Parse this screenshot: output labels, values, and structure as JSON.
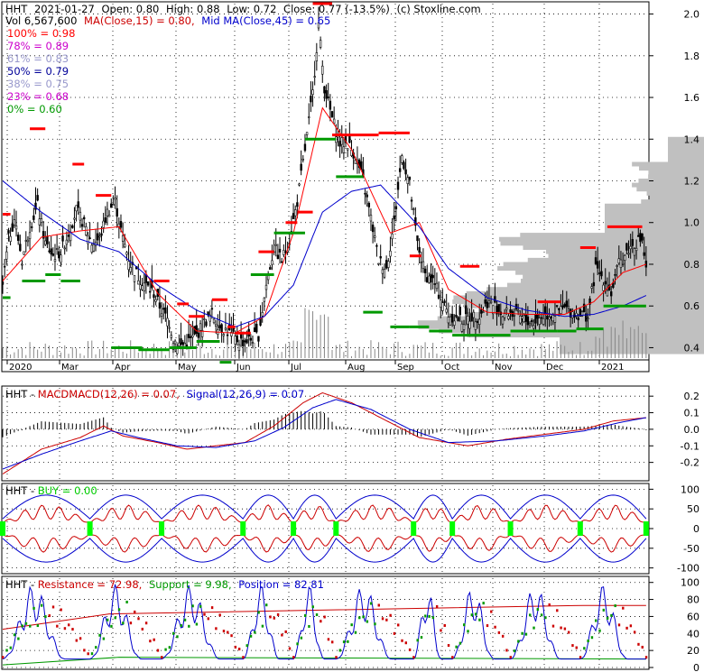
{
  "header": {
    "ticker": "HHT",
    "date": "2021-01-27",
    "open": "Open: 0.80",
    "high": "High: 0.88",
    "low": "Low: 0.72",
    "close": "Close: 0.77 (-13.5%)",
    "source": "(c) Stoxline.com",
    "volume": "Vol 6,567,600",
    "ma15": "MA(Close,15) = 0.80,",
    "ma45": "Mid MA(Close,45) = 0.65"
  },
  "fib_levels": [
    {
      "label": "100% = 0.98",
      "color": "#ff0000"
    },
    {
      "label": "78% = 0.89",
      "color": "#cc00cc"
    },
    {
      "label": "61% = 0.83",
      "color": "#9999cc"
    },
    {
      "label": "50% = 0.79",
      "color": "#000099"
    },
    {
      "label": "38% = 0.75",
      "color": "#9999cc"
    },
    {
      "label": "23% = 0.68",
      "color": "#cc00cc"
    },
    {
      "label": "0% = 0.60",
      "color": "#009900"
    }
  ],
  "colors": {
    "ma15": "#ff0000",
    "ma45": "#0000cc",
    "resistance": "#ff0000",
    "support": "#009900",
    "price": "#000000",
    "volume_profile": "#c0c0c0",
    "buy": "#00ff00",
    "position": "#0000cc"
  },
  "chart_data": [
    {
      "type": "candlestick",
      "title": "HHT 2021-01-27 Open: 0.80 High: 0.88 Low: 0.72 Close: 0.77 (-13.5%) (c) Stoxline.com",
      "x_ticks": [
        "2020",
        "Mar",
        "Apr",
        "May",
        "Jun",
        "Jul",
        "Aug",
        "Sep",
        "Oct",
        "Nov",
        "Dec",
        "2021"
      ],
      "y_ticks": [
        2.0,
        1.8,
        1.6,
        1.4,
        1.2,
        1.0,
        0.8,
        0.6,
        0.4
      ],
      "ylim": [
        0.35,
        2.05
      ],
      "price_path": [
        [
          0,
          0.7
        ],
        [
          3,
          0.92
        ],
        [
          6,
          1.02
        ],
        [
          10,
          0.82
        ],
        [
          14,
          0.98
        ],
        [
          18,
          1.08
        ],
        [
          22,
          0.9
        ],
        [
          26,
          0.84
        ],
        [
          30,
          0.86
        ],
        [
          34,
          0.95
        ],
        [
          38,
          1.06
        ],
        [
          42,
          0.99
        ],
        [
          46,
          0.9
        ],
        [
          50,
          0.92
        ],
        [
          54,
          1.05
        ],
        [
          58,
          1.1
        ],
        [
          62,
          0.92
        ],
        [
          66,
          0.8
        ],
        [
          70,
          0.74
        ],
        [
          74,
          0.7
        ],
        [
          78,
          0.66
        ],
        [
          82,
          0.58
        ],
        [
          86,
          0.52
        ],
        [
          88,
          0.44
        ],
        [
          92,
          0.41
        ],
        [
          96,
          0.43
        ],
        [
          100,
          0.46
        ],
        [
          104,
          0.52
        ],
        [
          108,
          0.56
        ],
        [
          112,
          0.5
        ],
        [
          116,
          0.48
        ],
        [
          120,
          0.44
        ],
        [
          124,
          0.43
        ],
        [
          128,
          0.44
        ],
        [
          132,
          0.46
        ],
        [
          136,
          0.7
        ],
        [
          140,
          0.88
        ],
        [
          144,
          0.82
        ],
        [
          148,
          0.92
        ],
        [
          152,
          1.1
        ],
        [
          156,
          1.35
        ],
        [
          160,
          1.62
        ],
        [
          163,
          1.95
        ],
        [
          166,
          1.65
        ],
        [
          170,
          1.5
        ],
        [
          174,
          1.38
        ],
        [
          178,
          1.38
        ],
        [
          182,
          1.32
        ],
        [
          186,
          1.2
        ],
        [
          190,
          1.02
        ],
        [
          194,
          0.82
        ],
        [
          198,
          0.78
        ],
        [
          202,
          1.0
        ],
        [
          206,
          1.32
        ],
        [
          210,
          1.18
        ],
        [
          214,
          0.9
        ],
        [
          218,
          0.75
        ],
        [
          222,
          0.72
        ],
        [
          226,
          0.64
        ],
        [
          230,
          0.56
        ],
        [
          234,
          0.54
        ],
        [
          238,
          0.53
        ],
        [
          242,
          0.55
        ],
        [
          246,
          0.55
        ],
        [
          250,
          0.62
        ],
        [
          254,
          0.6
        ],
        [
          258,
          0.56
        ],
        [
          262,
          0.57
        ],
        [
          266,
          0.55
        ],
        [
          270,
          0.53
        ],
        [
          274,
          0.52
        ],
        [
          278,
          0.55
        ],
        [
          282,
          0.56
        ],
        [
          286,
          0.57
        ],
        [
          290,
          0.59
        ],
        [
          294,
          0.57
        ],
        [
          298,
          0.56
        ],
        [
          302,
          0.55
        ],
        [
          306,
          0.78
        ],
        [
          310,
          0.73
        ],
        [
          314,
          0.66
        ],
        [
          318,
          0.8
        ],
        [
          322,
          0.86
        ],
        [
          326,
          0.9
        ],
        [
          330,
          0.92
        ],
        [
          332,
          0.77
        ]
      ],
      "ma15": [
        [
          0,
          0.72
        ],
        [
          20,
          0.93
        ],
        [
          40,
          0.96
        ],
        [
          60,
          0.98
        ],
        [
          80,
          0.66
        ],
        [
          100,
          0.48
        ],
        [
          120,
          0.47
        ],
        [
          135,
          0.55
        ],
        [
          150,
          0.95
        ],
        [
          165,
          1.55
        ],
        [
          180,
          1.35
        ],
        [
          200,
          0.95
        ],
        [
          215,
          1.0
        ],
        [
          230,
          0.68
        ],
        [
          250,
          0.57
        ],
        [
          270,
          0.56
        ],
        [
          290,
          0.56
        ],
        [
          305,
          0.62
        ],
        [
          320,
          0.76
        ],
        [
          332,
          0.8
        ]
      ],
      "ma45": [
        [
          0,
          1.2
        ],
        [
          20,
          1.05
        ],
        [
          40,
          0.92
        ],
        [
          60,
          0.86
        ],
        [
          80,
          0.7
        ],
        [
          100,
          0.58
        ],
        [
          120,
          0.5
        ],
        [
          135,
          0.55
        ],
        [
          150,
          0.7
        ],
        [
          165,
          1.05
        ],
        [
          180,
          1.15
        ],
        [
          195,
          1.18
        ],
        [
          215,
          0.98
        ],
        [
          230,
          0.78
        ],
        [
          250,
          0.64
        ],
        [
          270,
          0.58
        ],
        [
          290,
          0.55
        ],
        [
          305,
          0.56
        ],
        [
          320,
          0.6
        ],
        [
          332,
          0.65
        ]
      ],
      "resistance_segments": [
        [
          0,
          4,
          1.04
        ],
        [
          14,
          22,
          1.45
        ],
        [
          36,
          42,
          1.28
        ],
        [
          48,
          56,
          1.13
        ],
        [
          78,
          86,
          0.72
        ],
        [
          90,
          96,
          0.61
        ],
        [
          96,
          104,
          0.55
        ],
        [
          108,
          116,
          0.63
        ],
        [
          116,
          120,
          0.5
        ],
        [
          120,
          128,
          0.47
        ],
        [
          132,
          140,
          0.86
        ],
        [
          146,
          152,
          1.0
        ],
        [
          152,
          160,
          1.05
        ],
        [
          160,
          170,
          2.05
        ],
        [
          170,
          194,
          1.42
        ],
        [
          194,
          210,
          1.43
        ],
        [
          210,
          216,
          0.84
        ],
        [
          236,
          246,
          0.79
        ],
        [
          276,
          288,
          0.62
        ],
        [
          298,
          306,
          0.88
        ],
        [
          312,
          330,
          0.98
        ]
      ],
      "support_segments": [
        [
          0,
          4,
          0.64
        ],
        [
          10,
          22,
          0.72
        ],
        [
          22,
          30,
          0.75
        ],
        [
          30,
          40,
          0.72
        ],
        [
          56,
          72,
          0.4
        ],
        [
          70,
          86,
          0.39
        ],
        [
          86,
          100,
          0.4
        ],
        [
          100,
          112,
          0.43
        ],
        [
          112,
          118,
          0.33
        ],
        [
          128,
          140,
          0.75
        ],
        [
          140,
          156,
          0.95
        ],
        [
          156,
          172,
          1.4
        ],
        [
          172,
          186,
          1.22
        ],
        [
          186,
          196,
          0.57
        ],
        [
          200,
          210,
          0.5
        ],
        [
          210,
          220,
          0.5
        ],
        [
          220,
          232,
          0.48
        ],
        [
          232,
          262,
          0.46
        ],
        [
          262,
          286,
          0.48
        ],
        [
          286,
          296,
          0.48
        ],
        [
          296,
          310,
          0.49
        ],
        [
          310,
          332,
          0.6
        ]
      ]
    },
    {
      "type": "line",
      "title": "HHT - MACDMACD(12,26) = 0.07, Signal(12,26,9) = 0.07",
      "y_ticks": [
        0.2,
        0.1,
        0.0,
        -0.1,
        -0.2
      ],
      "ylim": [
        -0.3,
        0.25
      ],
      "series": [
        {
          "name": "MACD(12,26)",
          "values": [
            [
              0,
              -0.27
            ],
            [
              20,
              -0.12
            ],
            [
              40,
              -0.05
            ],
            [
              52,
              0.02
            ],
            [
              62,
              -0.04
            ],
            [
              80,
              -0.08
            ],
            [
              95,
              -0.12
            ],
            [
              110,
              -0.1
            ],
            [
              125,
              -0.08
            ],
            [
              140,
              0.02
            ],
            [
              155,
              0.16
            ],
            [
              165,
              0.22
            ],
            [
              180,
              0.16
            ],
            [
              200,
              0.04
            ],
            [
              215,
              -0.05
            ],
            [
              240,
              -0.1
            ],
            [
              260,
              -0.06
            ],
            [
              280,
              -0.03
            ],
            [
              300,
              0.0
            ],
            [
              315,
              0.05
            ],
            [
              332,
              0.07
            ]
          ]
        },
        {
          "name": "Signal(12,26,9)",
          "values": [
            [
              0,
              -0.24
            ],
            [
              20,
              -0.15
            ],
            [
              40,
              -0.07
            ],
            [
              56,
              -0.01
            ],
            [
              70,
              -0.05
            ],
            [
              90,
              -0.1
            ],
            [
              110,
              -0.11
            ],
            [
              130,
              -0.07
            ],
            [
              145,
              0.01
            ],
            [
              160,
              0.13
            ],
            [
              172,
              0.18
            ],
            [
              190,
              0.12
            ],
            [
              210,
              0.0
            ],
            [
              230,
              -0.08
            ],
            [
              255,
              -0.07
            ],
            [
              280,
              -0.04
            ],
            [
              300,
              -0.01
            ],
            [
              318,
              0.04
            ],
            [
              332,
              0.07
            ]
          ]
        }
      ]
    },
    {
      "type": "line",
      "title": "HHT - BUY = 0.00",
      "y_ticks": [
        100,
        50,
        0,
        -50,
        -100
      ],
      "ylim": [
        -110,
        110
      ]
    },
    {
      "type": "line",
      "title": "HHT - Resistance = 72.98, Support = 9.98, Position = 82.81",
      "y_ticks": [
        100,
        80,
        60,
        40,
        20,
        0
      ],
      "ylim": [
        0,
        105
      ],
      "series": [
        {
          "name": "Resistance",
          "value": 72.98
        },
        {
          "name": "Support",
          "value": 9.98
        },
        {
          "name": "Position",
          "value": 82.81
        }
      ]
    }
  ],
  "macd_panel": {
    "ticker": "HHT",
    "sep": " - ",
    "label1": "MACDMACD(12,26) = 0.07,",
    "label2": "Signal(12,26,9) = 0.07"
  },
  "buy_panel": {
    "ticker": "HHT",
    "sep": " - ",
    "label": "BUY = 0.00"
  },
  "pos_panel": {
    "ticker": "HHT",
    "sep": " - ",
    "res": "Resistance = 72.98,",
    "sup": "Support = 9.98,",
    "pos": "Position = 82.81"
  }
}
